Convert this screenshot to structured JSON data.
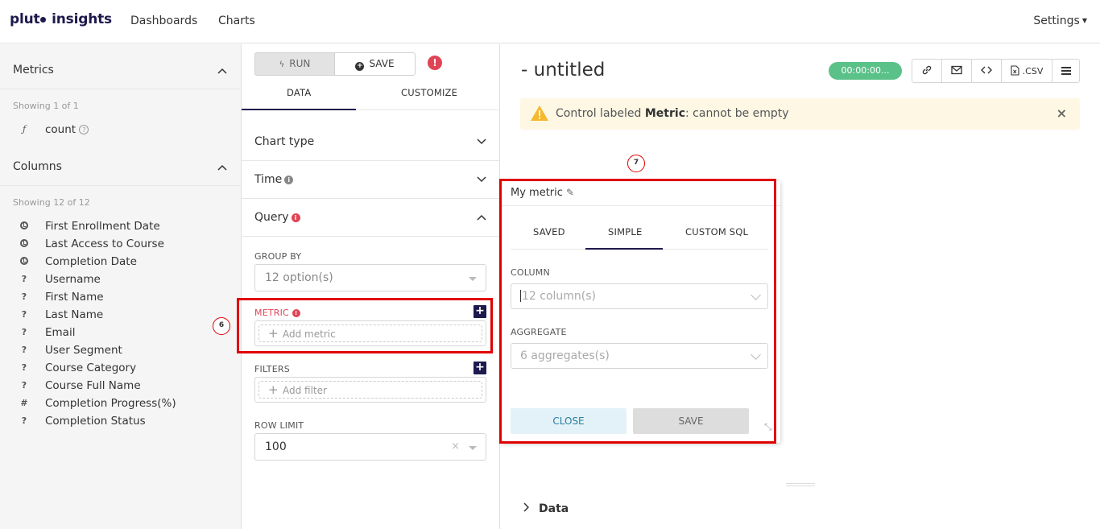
{
  "app": {
    "brand": "plut",
    "brand_suffix": "insights"
  },
  "nav": {
    "dashboards": "Dashboards",
    "charts": "Charts",
    "settings": "Settings"
  },
  "left": {
    "metrics_title": "Metrics",
    "metrics_showing": "Showing 1 of 1",
    "metrics": [
      {
        "icon": "ƒ",
        "label": "count"
      }
    ],
    "columns_title": "Columns",
    "columns_showing": "Showing 12 of 12",
    "columns": [
      {
        "type": "time",
        "label": "First Enrollment Date"
      },
      {
        "type": "time",
        "label": "Last Access to Course"
      },
      {
        "type": "time",
        "label": "Completion Date"
      },
      {
        "type": "?",
        "label": "Username"
      },
      {
        "type": "?",
        "label": "First Name"
      },
      {
        "type": "?",
        "label": "Last Name"
      },
      {
        "type": "?",
        "label": "Email"
      },
      {
        "type": "?",
        "label": "User Segment"
      },
      {
        "type": "?",
        "label": "Course Category"
      },
      {
        "type": "?",
        "label": "Course Full Name"
      },
      {
        "type": "#",
        "label": "Completion Progress(%)"
      },
      {
        "type": "?",
        "label": "Completion Status"
      }
    ]
  },
  "mid": {
    "run_label": "RUN",
    "save_label": "SAVE",
    "warn_glyph": "!",
    "tab_data": "DATA",
    "tab_customize": "CUSTOMIZE",
    "section_chart_type": "Chart type",
    "section_time": "Time",
    "section_query": "Query",
    "group_by_label": "GROUP BY",
    "group_by_value": "12 option(s)",
    "metric_label": "METRIC",
    "metric_placeholder": "Add metric",
    "filters_label": "FILTERS",
    "filters_placeholder": "Add filter",
    "row_limit_label": "ROW LIMIT",
    "row_limit_value": "100",
    "badge_6": "6"
  },
  "right": {
    "title": "- untitled",
    "timer": "00:00:00...",
    "csv_label": ".CSV",
    "alert_prefix": "Control labeled ",
    "alert_bold": "Metric",
    "alert_suffix": ": cannot be empty",
    "data_toggle": "Data",
    "badge_7": "7"
  },
  "popover": {
    "title": "My metric",
    "tabs": [
      "SAVED",
      "SIMPLE",
      "CUSTOM SQL"
    ],
    "column_label": "COLUMN",
    "column_placeholder": "12 column(s)",
    "aggregate_label": "AGGREGATE",
    "aggregate_placeholder": "6 aggregates(s)",
    "close_label": "CLOSE",
    "save_label": "SAVE"
  },
  "colors": {
    "brand": "#1e1a4d",
    "danger": "#e04355",
    "success": "#5ac189",
    "annotation": "#e00000"
  }
}
